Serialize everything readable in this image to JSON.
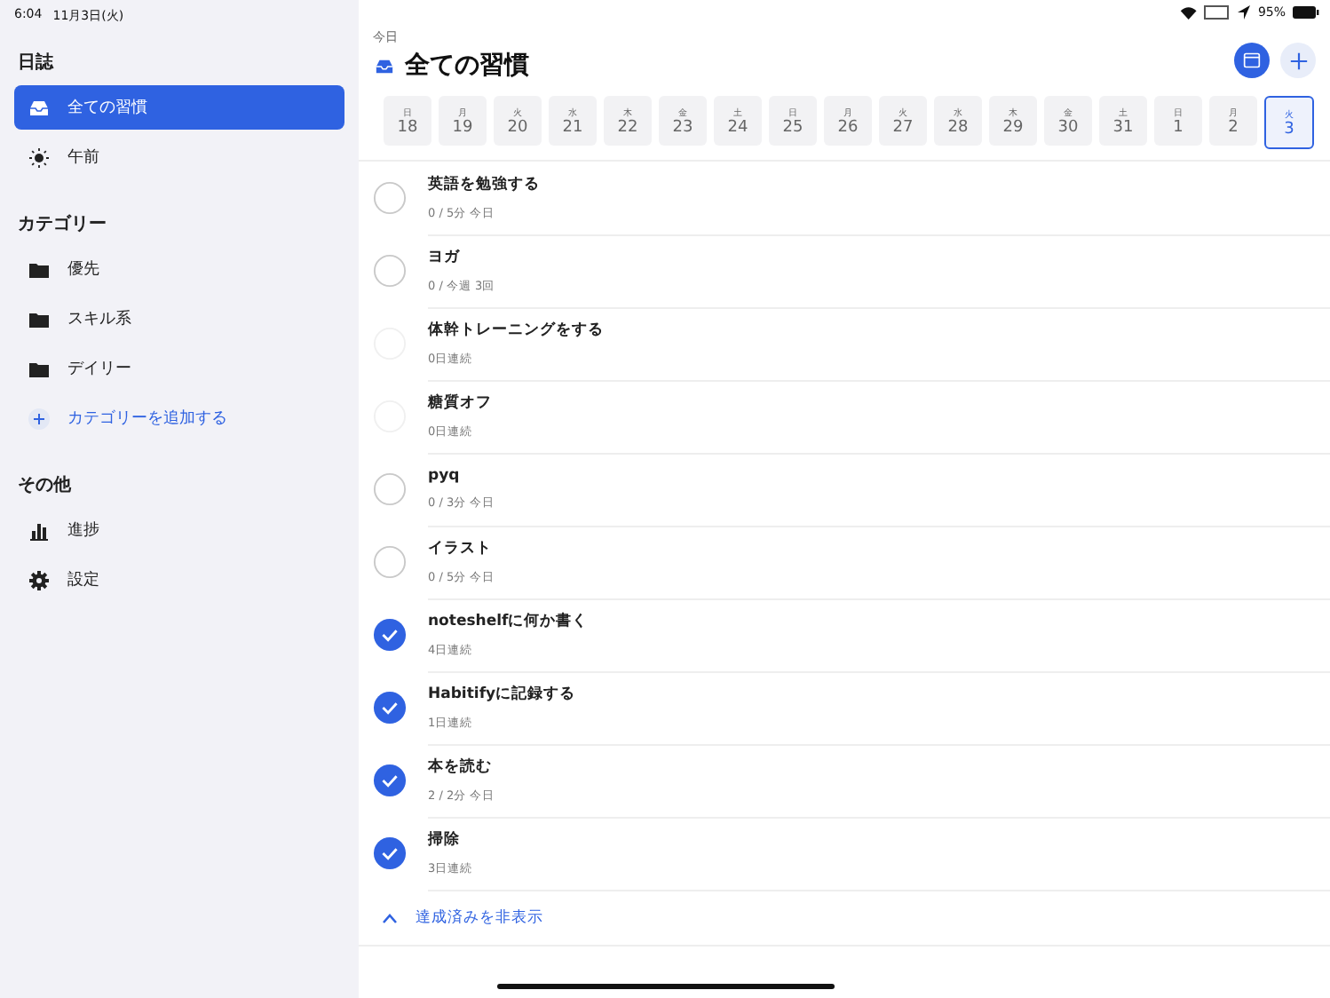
{
  "status_bar": {
    "time": "6:04",
    "date": "11月3日(火)",
    "battery": "95%"
  },
  "sidebar": {
    "sections": [
      {
        "title": "日誌",
        "items": [
          {
            "label": "全ての習慣",
            "kind": "inbox",
            "selected": true
          },
          {
            "label": "午前",
            "kind": "period",
            "selected": false
          }
        ]
      },
      {
        "title": "カテゴリー",
        "items": [
          {
            "label": "優先",
            "kind": "category",
            "selected": false
          },
          {
            "label": "スキル系",
            "kind": "category",
            "selected": false
          },
          {
            "label": "デイリー",
            "kind": "category",
            "selected": false
          },
          {
            "label": "カテゴリーを追加する",
            "kind": "action",
            "selected": false
          }
        ]
      },
      {
        "title": "その他",
        "items": [
          {
            "label": "進捗",
            "kind": "progress",
            "selected": false
          },
          {
            "label": "設定",
            "kind": "settings",
            "selected": false
          }
        ]
      }
    ]
  },
  "header": {
    "subtitle": "今日",
    "title": "全ての習慣"
  },
  "dates": [
    {
      "weekday": "日",
      "day": "18",
      "selected": false
    },
    {
      "weekday": "月",
      "day": "19",
      "selected": false
    },
    {
      "weekday": "火",
      "day": "20",
      "selected": false
    },
    {
      "weekday": "水",
      "day": "21",
      "selected": false
    },
    {
      "weekday": "木",
      "day": "22",
      "selected": false
    },
    {
      "weekday": "金",
      "day": "23",
      "selected": false
    },
    {
      "weekday": "土",
      "day": "24",
      "selected": false
    },
    {
      "weekday": "日",
      "day": "25",
      "selected": false
    },
    {
      "weekday": "月",
      "day": "26",
      "selected": false
    },
    {
      "weekday": "火",
      "day": "27",
      "selected": false
    },
    {
      "weekday": "水",
      "day": "28",
      "selected": false
    },
    {
      "weekday": "木",
      "day": "29",
      "selected": false
    },
    {
      "weekday": "金",
      "day": "30",
      "selected": false
    },
    {
      "weekday": "土",
      "day": "31",
      "selected": false
    },
    {
      "weekday": "日",
      "day": "1",
      "selected": false
    },
    {
      "weekday": "月",
      "day": "2",
      "selected": false
    },
    {
      "weekday": "火",
      "day": "3",
      "selected": true
    }
  ],
  "habits": [
    {
      "name": "英語を勉強する",
      "detail": "0 / 5分 今日",
      "checked": false,
      "dimmed": false
    },
    {
      "name": "ヨガ",
      "detail": "0 / 今週 3回",
      "checked": false,
      "dimmed": false
    },
    {
      "name": "体幹トレーニングをする",
      "detail": "0日連続",
      "checked": false,
      "dimmed": true
    },
    {
      "name": "糖質オフ",
      "detail": "0日連続",
      "checked": false,
      "dimmed": true
    },
    {
      "name": "pyq",
      "detail": "0 / 3分 今日",
      "checked": false,
      "dimmed": false
    },
    {
      "name": "イラスト",
      "detail": "0 / 5分 今日",
      "checked": false,
      "dimmed": false
    },
    {
      "name": "noteshelfに何か書く",
      "detail": "4日連続",
      "checked": true,
      "dimmed": false
    },
    {
      "name": "Habitifyに記録する",
      "detail": "1日連続",
      "checked": true,
      "dimmed": false
    },
    {
      "name": "本を読む",
      "detail": "2 / 2分 今日",
      "checked": true,
      "dimmed": false
    },
    {
      "name": "掃除",
      "detail": "3日連続",
      "checked": true,
      "dimmed": false
    }
  ],
  "hide_completed": {
    "label": "達成済みを非表示"
  }
}
